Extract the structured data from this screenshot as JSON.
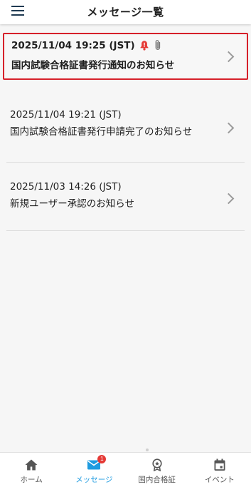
{
  "header": {
    "title": "メッセージ一覧",
    "menu_icon": "hamburger-menu-icon"
  },
  "messages": [
    {
      "timestamp": "2025/11/04 19:25 (JST)",
      "subject": "国内試験合格証書発行通知のお知らせ",
      "unread": true,
      "important": true,
      "has_attachment": true,
      "highlight_color": "#d6202a"
    },
    {
      "timestamp": "2025/11/04 19:21 (JST)",
      "subject": "国内試験合格証書発行申請完了のお知らせ",
      "unread": false
    },
    {
      "timestamp": "2025/11/03 14:26 (JST)",
      "subject": "新規ユーザー承認のお知らせ",
      "unread": false
    }
  ],
  "tabbar": {
    "tabs": [
      {
        "label": "ホーム",
        "icon": "home-icon"
      },
      {
        "label": "メッセージ",
        "icon": "mail-icon",
        "badge": "1",
        "active": true
      },
      {
        "label": "国内合格証",
        "icon": "award-icon"
      },
      {
        "label": "イベント",
        "icon": "calendar-icon"
      }
    ],
    "active_color": "#1e9be0"
  }
}
